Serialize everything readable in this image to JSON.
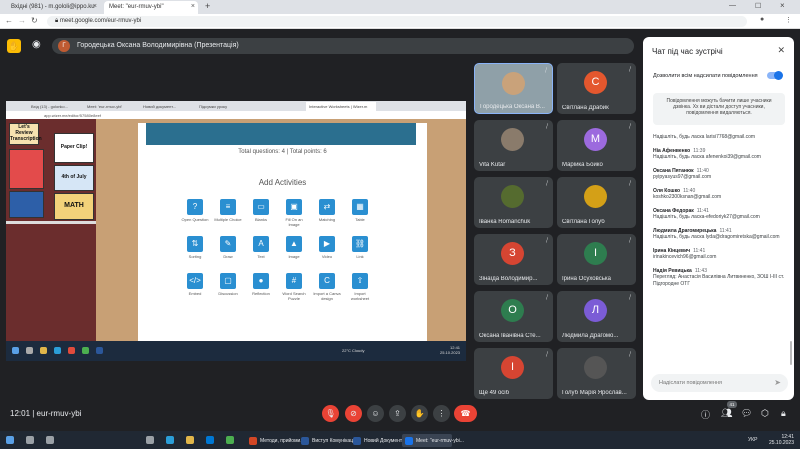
{
  "browser": {
    "tabs": [
      {
        "label": "Вхідні (981) - m.gololi@ippo.ku"
      },
      {
        "label": "Meet: \"eur-rmuv-ybi\""
      }
    ],
    "url": "meet.google.com/eur-rmuv-ybi"
  },
  "presenter": {
    "initial": "Г",
    "name": "Городецька Оксана Володимирівна (Презентація)"
  },
  "screen": {
    "tabs": [
      "Вхід (13) - golonko...",
      "Meet: 'eur-rmuv-ybi'",
      "Новий документ...",
      "Підсумки уроку",
      "Interactive Worksheets | Wizer.m"
    ],
    "url": "app.wizer.me/editor/57580e8eef",
    "sidebar_thumbs": [
      "Paper Clip!",
      "4th of July",
      "MATH",
      "Let's Review Transcription"
    ],
    "totals": "Total questions: 4 | Total points: 6",
    "add_title": "Add Activities",
    "activities": [
      {
        "label": "Open Question",
        "icon": "?"
      },
      {
        "label": "Multiple Choice",
        "icon": "≡"
      },
      {
        "label": "Blanks",
        "icon": "▭"
      },
      {
        "label": "Fill On an Image",
        "icon": "▣"
      },
      {
        "label": "Matching",
        "icon": "⇄"
      },
      {
        "label": "Table",
        "icon": "▦"
      },
      {
        "label": "Sorting",
        "icon": "⇅"
      },
      {
        "label": "Draw",
        "icon": "✎"
      },
      {
        "label": "Text",
        "icon": "A"
      },
      {
        "label": "Image",
        "icon": "▲"
      },
      {
        "label": "Video",
        "icon": "▶"
      },
      {
        "label": "Link",
        "icon": "⛓"
      },
      {
        "label": "Embed",
        "icon": "</>"
      },
      {
        "label": "Discussion",
        "icon": "▢"
      },
      {
        "label": "Reflection",
        "icon": "●"
      },
      {
        "label": "Word Search Puzzle",
        "icon": "#"
      },
      {
        "label": "Import a Canva design",
        "icon": "C"
      },
      {
        "label": "Import worksheet",
        "icon": "⇧"
      }
    ],
    "weather": "22°C Cloudy",
    "clock_time": "12:41",
    "clock_date": "25.10.2023"
  },
  "tiles": [
    {
      "name": "Городецька Оксана В...",
      "initial": "",
      "color": "#c9a27a",
      "self": true
    },
    {
      "name": "Світлана Драбик",
      "initial": "С",
      "color": "#e4572e"
    },
    {
      "name": "Vita Kutar",
      "initial": "",
      "color": "#8a7b6b"
    },
    {
      "name": "Марійка Бойко",
      "initial": "М",
      "color": "#9c6ade"
    },
    {
      "name": "Іванка Romanchuk",
      "initial": "",
      "color": "#556b2f"
    },
    {
      "name": "Світлана Голуб",
      "initial": "",
      "color": "#d4a017"
    },
    {
      "name": "Зінаїда Володимир...",
      "initial": "З",
      "color": "#d64532"
    },
    {
      "name": "Ірина Осуховська",
      "initial": "І",
      "color": "#2e7d4f"
    },
    {
      "name": "Оксана Іванівна Сте...",
      "initial": "О",
      "color": "#2e7d4f"
    },
    {
      "name": "Людмила Драгомо...",
      "initial": "Л",
      "color": "#7b5cd6"
    },
    {
      "name": "Ще 49 осіб",
      "initial": "І",
      "color": "#d64532"
    },
    {
      "name": "Голуб Марія Ярослав...",
      "initial": "",
      "color": "#555"
    }
  ],
  "chat": {
    "title": "Чат під час зустрічі",
    "allow_label": "Дозволити всім надсилати повідомлення",
    "notice": "Повідомлення можуть бачити лише учасники дзвінка. Хх ви дістали доступ учасники, повідомлення видаляються.",
    "messages": [
      {
        "who": "",
        "time": "",
        "text": "Надішліть, будь ласка larisi7768@gmail.com"
      },
      {
        "who": "Ніа Афенвенко",
        "time": "11:39",
        "text": "Надішліть, будь ласка afenenkoi39@gmail.com"
      },
      {
        "who": "Оксана Пятанюк",
        "time": "11:40",
        "text": "pyipyasyus97@gmail.com"
      },
      {
        "who": "Оля Кошко",
        "time": "11:40",
        "text": "koshko2300ksnan@gmail.com"
      },
      {
        "who": "Оксана Федорак",
        "time": "11:41",
        "text": "Надішліть, будь ласка-efedoriyk27@gmail.com"
      },
      {
        "who": "Людмила Драгомирецька",
        "time": "11:41",
        "text": "Надішліть, будь ласка lyda@dragomiretska@gmail.com"
      },
      {
        "who": "Ірина Кінцевич",
        "time": "11:41",
        "text": "irinakincevich96@gmail.com"
      },
      {
        "who": "Надія Ревицька",
        "time": "11:43",
        "text": "Перегляд: Анастасія Василівна Литвиненко, ЗОШ I-III ст. Підгородне ОТГ"
      }
    ],
    "input_placeholder": "Надіслати повідомлення"
  },
  "meeting_code": "12:01  |  eur-rmuv-ybi",
  "people_count": "41",
  "taskbar": {
    "apps": [
      {
        "label": "Методи, прийоми...",
        "color": "#d24726"
      },
      {
        "label": "Виступ Комунікац...",
        "color": "#2b579a"
      },
      {
        "label": "Новий Документ ...",
        "color": "#2b579a"
      },
      {
        "label": "Meet: \"eur-rmuv-ybi...",
        "color": "#1a73e8"
      }
    ],
    "lang": "УКР",
    "time": "12:41",
    "date": "25.10.2023"
  }
}
